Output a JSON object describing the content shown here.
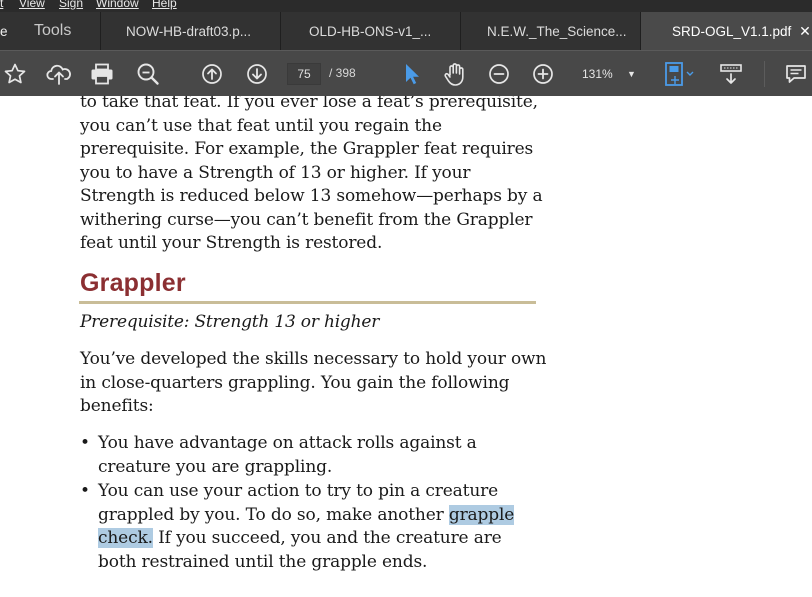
{
  "menu": {
    "items": [
      "t",
      "View",
      "Sign",
      "Window",
      "Help"
    ]
  },
  "tabs": {
    "first_label": "e",
    "tools_label": "Tools",
    "docs": [
      "NOW-HB-draft03.p...",
      "OLD-HB-ONS-v1_...",
      "N.E.W._The_Science...",
      "SRD-OGL_V1.1.pdf"
    ],
    "close_glyph": "✕"
  },
  "toolbar": {
    "icons": [
      "star-icon",
      "upload-cloud-icon",
      "print-icon",
      "zoom-search-icon",
      "page-up-icon",
      "page-down-icon",
      "select-cursor-icon",
      "hand-tool-icon",
      "zoom-out-icon",
      "zoom-in-icon",
      "fit-page-icon",
      "scrolling-mode-icon",
      "comment-icon"
    ],
    "current_page": "75",
    "total_pages": "/ 398",
    "zoom": "131%",
    "zoom_arrow": "▼",
    "accent_color": "#4a9be8"
  },
  "document": {
    "paragraph1": "to take that feat. If you ever lose a feat’s prerequisite, you can’t use that feat until you regain the prerequisite. For example, the Grappler feat requires you to have a Strength of 13 or higher. If your Strength is reduced below 13 somehow—perhaps by a withering curse—you can’t benefit from the Grappler feat until your Strength is restored.",
    "heading": "Grappler",
    "heading_color": "#8b2f32",
    "prerequisite": "Prerequisite: Strength 13 or higher",
    "paragraph2": "You’ve developed the skills necessary to hold your own in close-quarters grappling. You gain the following benefits:",
    "bullet_glyph": "•",
    "bullet1": "You have advantage on attack rolls against a creature you are grappling.",
    "bullet2_before": "You can use your action to try to pin a creature grappled by you. To do so, make another ",
    "bullet2_highlight": "grapple check.",
    "bullet2_after": " If you succeed, you and the creature are both restrained until the grapple ends.",
    "highlight_color": "#aecbe2"
  }
}
